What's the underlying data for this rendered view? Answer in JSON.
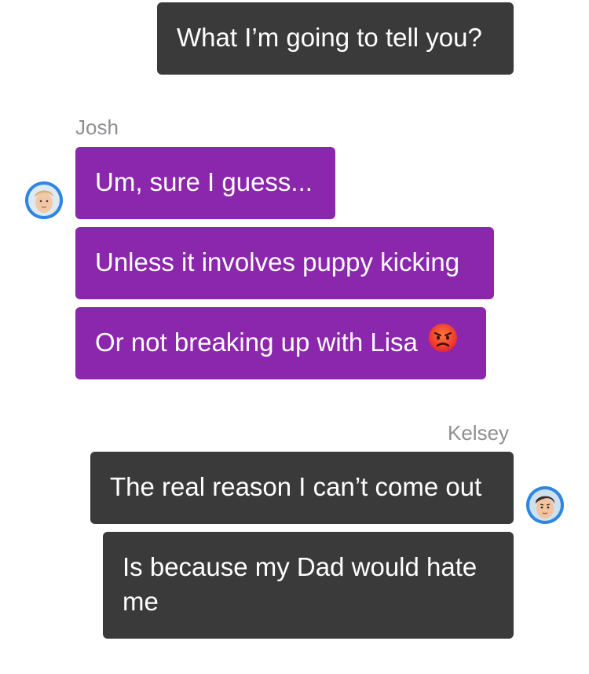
{
  "messages": [
    {
      "id": "m1",
      "sender": "Kelsey",
      "text": "What I’m going to tell you?"
    },
    {
      "id": "m2",
      "sender": "Josh",
      "text": "Um, sure I guess..."
    },
    {
      "id": "m3",
      "sender": "Josh",
      "text": "Unless it involves puppy kicking"
    },
    {
      "id": "m4",
      "sender": "Josh",
      "text": "Or not breaking up with Lisa",
      "emoji": "angry-face"
    },
    {
      "id": "m5",
      "sender": "Kelsey",
      "text": "The real reason I can’t come out"
    },
    {
      "id": "m6",
      "sender": "Kelsey",
      "text": "Is because my Dad would hate me"
    }
  ],
  "senders": {
    "josh": {
      "name": "Josh",
      "avatar": "josh-avatar",
      "bubble_color": "#8b27ad"
    },
    "kelsey": {
      "name": "Kelsey",
      "avatar": "kelsey-avatar",
      "bubble_color": "#3a3a3a"
    }
  },
  "colors": {
    "background": "#ffffff",
    "name_label": "#8e8e93",
    "text": "#ffffff",
    "avatar_ring": "#2f86e0"
  }
}
